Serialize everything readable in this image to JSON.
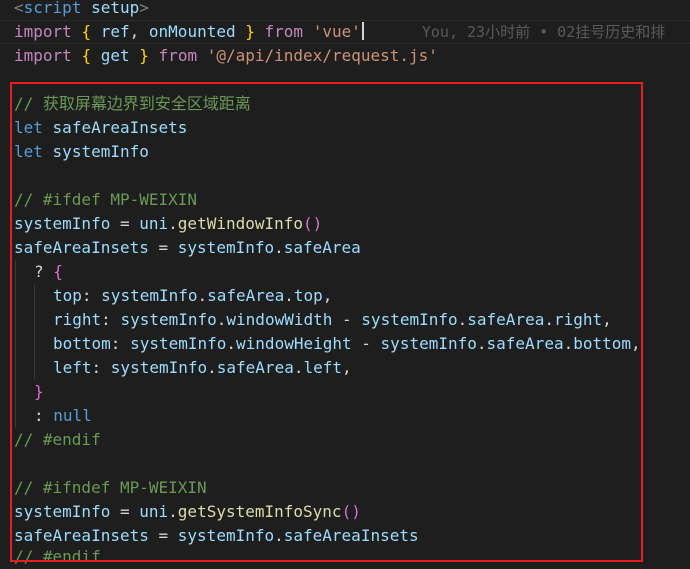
{
  "blame": "You, 23小时前 • 02挂号历史和排",
  "lines": {
    "l0": {
      "open": "<",
      "tag": "script",
      "attr": "setup",
      "close": ">"
    },
    "l1": {
      "kw": "import",
      "b1": "{",
      "a": "ref",
      "c": ",",
      "b": "onMounted",
      "b2": "}",
      "from": "from",
      "str": "'vue'"
    },
    "l2": {
      "kw": "import",
      "b1": "{",
      "a": "get",
      "b2": "}",
      "from": "from",
      "str": "'@/api/index/request.js'"
    },
    "l4": "// 获取屏幕边界到安全区域距离",
    "l5": {
      "kw": "let",
      "v": "safeAreaInsets"
    },
    "l6": {
      "kw": "let",
      "v": "systemInfo"
    },
    "l8": "// #ifdef MP-WEIXIN",
    "l9": {
      "v": "systemInfo",
      "eq": "=",
      "obj": "uni",
      "fn": "getWindowInfo",
      "p": "()"
    },
    "l10": {
      "v": "safeAreaInsets",
      "eq": "=",
      "a": "systemInfo",
      "b": "safeArea"
    },
    "l11": {
      "q": "?",
      "b": "{"
    },
    "l12": {
      "k": "top",
      "a": "systemInfo",
      "b": "safeArea",
      "c": "top"
    },
    "l13": {
      "k": "right",
      "a": "systemInfo",
      "b": "windowWidth",
      "op": "-",
      "d": "systemInfo",
      "e": "safeArea",
      "f": "right"
    },
    "l14": {
      "k": "bottom",
      "a": "systemInfo",
      "b": "windowHeight",
      "op": "-",
      "d": "systemInfo",
      "e": "safeArea",
      "f": "bottom"
    },
    "l15": {
      "k": "left",
      "a": "systemInfo",
      "b": "safeArea",
      "c": "left"
    },
    "l16": {
      "b": "}"
    },
    "l17": {
      "c": ":",
      "n": "null"
    },
    "l18": "// #endif",
    "l20": "// #ifndef MP-WEIXIN",
    "l21": {
      "v": "systemInfo",
      "eq": "=",
      "obj": "uni",
      "fn": "getSystemInfoSync",
      "p": "()"
    },
    "l22": {
      "v": "safeAreaInsets",
      "eq": "=",
      "a": "systemInfo",
      "b": "safeAreaInsets"
    },
    "l23": "// #endif"
  },
  "colors": {
    "highlight_border": "#e81e1e",
    "background": "#1e1e1e"
  }
}
